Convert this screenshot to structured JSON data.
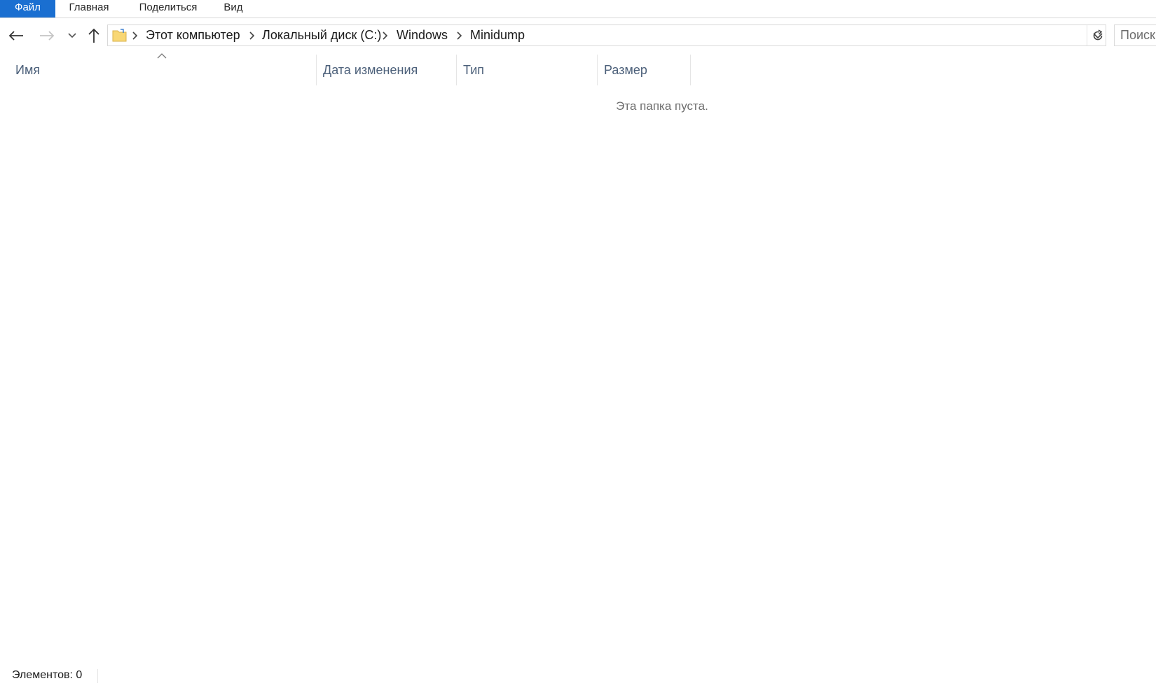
{
  "ribbon": {
    "tabs": [
      {
        "label": "Файл",
        "active": true
      },
      {
        "label": "Главная"
      },
      {
        "label": "Поделиться"
      },
      {
        "label": "Вид"
      }
    ]
  },
  "nav": {
    "back_icon": "arrow-left-icon",
    "forward_icon": "arrow-right-icon",
    "recent_icon": "chevron-down-icon",
    "up_icon": "arrow-up-icon",
    "refresh_icon": "refresh-icon"
  },
  "address": {
    "breadcrumbs": [
      "Этот компьютер",
      "Локальный диск (C:)",
      "Windows",
      "Minidump"
    ]
  },
  "search": {
    "placeholder": "Поиск"
  },
  "columns": {
    "name": "Имя",
    "date": "Дата изменения",
    "type": "Тип",
    "size": "Размер",
    "sorted_by": "name",
    "sort_direction": "ascending"
  },
  "content": {
    "empty_message": "Эта папка пуста."
  },
  "status": {
    "item_count": "Элементов: 0"
  },
  "colors": {
    "accent": "#1a6fd1",
    "header_text": "#4c607a",
    "folder_yellow": "#f8d775"
  }
}
